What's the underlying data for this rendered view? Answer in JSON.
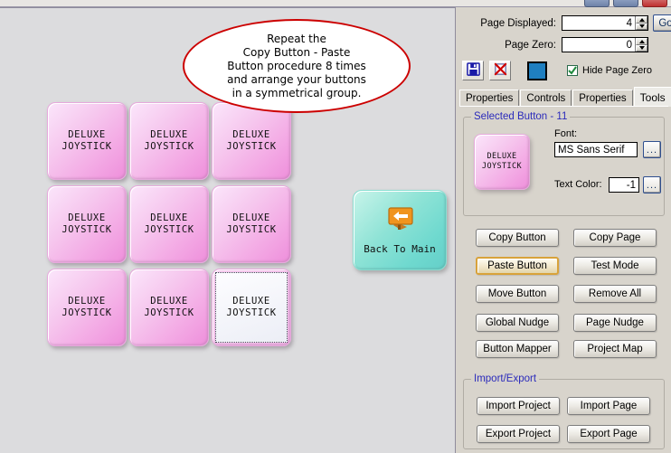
{
  "window": {
    "buttons": [
      "minimize",
      "maximize",
      "close"
    ]
  },
  "canvas": {
    "callout": {
      "lines": [
        "Repeat the",
        "Copy Button - Paste",
        "Button procedure 8 times",
        "and arrange your buttons",
        "in a symmetrical group."
      ],
      "border_color": "#cc0000"
    },
    "grid_buttons": [
      {
        "line1": "DELUXE",
        "line2": "JOYSTICK",
        "selected": false
      },
      {
        "line1": "DELUXE",
        "line2": "JOYSTICK",
        "selected": false
      },
      {
        "line1": "DELUXE",
        "line2": "JOYSTICK",
        "selected": false
      },
      {
        "line1": "DELUXE",
        "line2": "JOYSTICK",
        "selected": false
      },
      {
        "line1": "DELUXE",
        "line2": "JOYSTICK",
        "selected": false
      },
      {
        "line1": "DELUXE",
        "line2": "JOYSTICK",
        "selected": false
      },
      {
        "line1": "DELUXE",
        "line2": "JOYSTICK",
        "selected": false
      },
      {
        "line1": "DELUXE",
        "line2": "JOYSTICK",
        "selected": false
      },
      {
        "line1": "DELUXE",
        "line2": "JOYSTICK",
        "selected": true
      }
    ],
    "back_button": {
      "label": "Back To Main",
      "icon": "sign-left-arrow-icon",
      "color": "#7fdcd0"
    }
  },
  "panel": {
    "page_displayed": {
      "label": "Page Displayed:",
      "value": "4"
    },
    "page_zero": {
      "label": "Page Zero:",
      "value": "0"
    },
    "go_button": "Go",
    "save_icon": "floppy-save-icon",
    "delete_icon": "red-x-delete-icon",
    "color_swatch": "#1f7fc0",
    "hide_page_zero": {
      "label": "Hide Page Zero",
      "checked": true
    },
    "tabs": [
      {
        "label": "Properties",
        "active": false
      },
      {
        "label": "Controls",
        "active": false
      },
      {
        "label": "Properties",
        "active": false
      },
      {
        "label": "Tools",
        "active": true
      }
    ],
    "selected_button_group": {
      "title": "Selected Button - 11",
      "preview": {
        "line1": "DELUXE",
        "line2": "JOYSTICK"
      },
      "font_label": "Font:",
      "font_value": "MS Sans Serif",
      "font_browse": "...",
      "text_color_label": "Text Color:",
      "text_color_value": "-1",
      "text_color_browse": "..."
    },
    "tool_buttons": [
      {
        "label": "Copy Button",
        "focused": false
      },
      {
        "label": "Copy Page",
        "focused": false
      },
      {
        "label": "Paste Button",
        "focused": true
      },
      {
        "label": "Test Mode",
        "focused": false
      },
      {
        "label": "Move Button",
        "focused": false
      },
      {
        "label": "Remove All",
        "focused": false
      },
      {
        "label": "Global Nudge",
        "focused": false
      },
      {
        "label": "Page Nudge",
        "focused": false
      },
      {
        "label": "Button Mapper",
        "focused": false
      },
      {
        "label": "Project Map",
        "focused": false
      }
    ],
    "import_export": {
      "title": "Import/Export",
      "buttons": [
        {
          "label": "Import Project"
        },
        {
          "label": "Import Page"
        },
        {
          "label": "Export Project"
        },
        {
          "label": "Export Page"
        }
      ]
    }
  }
}
